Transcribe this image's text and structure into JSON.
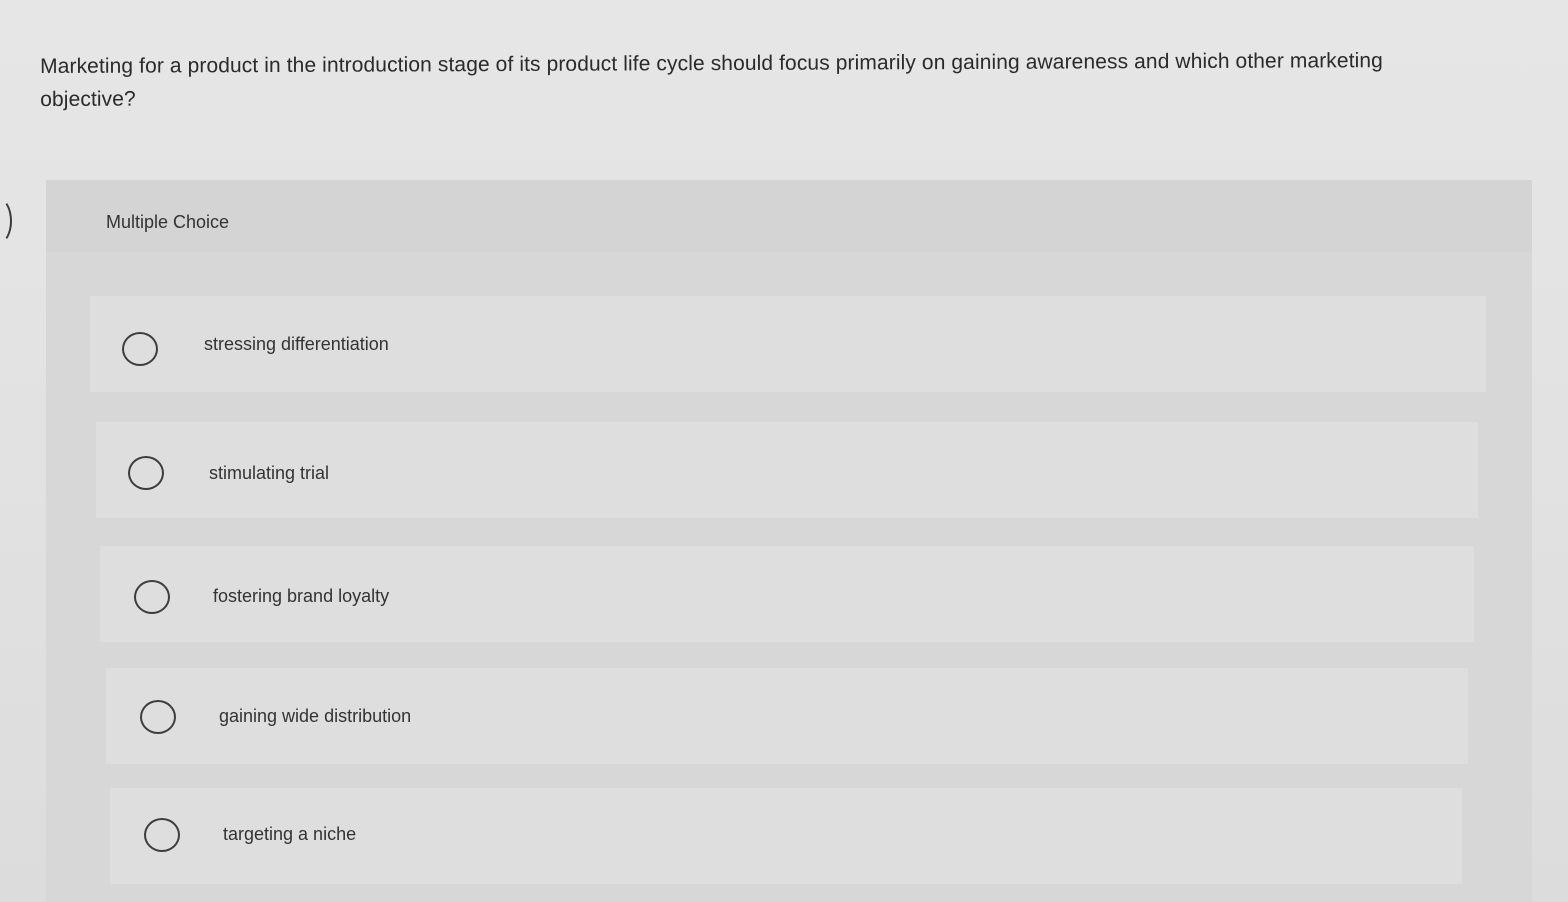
{
  "question": {
    "text": "Marketing for a product in the introduction stage of its product life cycle should focus primarily on gaining awareness and which other marketing objective?"
  },
  "multiple_choice": {
    "title": "Multiple Choice",
    "options": [
      {
        "label": "stressing differentiation",
        "selected": false
      },
      {
        "label": "stimulating trial",
        "selected": false
      },
      {
        "label": "fostering brand loyalty",
        "selected": false
      },
      {
        "label": "gaining wide distribution",
        "selected": false
      },
      {
        "label": "targeting a niche",
        "selected": false
      }
    ]
  },
  "colors": {
    "background": "#e4e4e4",
    "panel": "#d7d7d7",
    "option_row": "#dedede",
    "text": "#2f2f2f",
    "radio_border": "#3d3d3d"
  }
}
